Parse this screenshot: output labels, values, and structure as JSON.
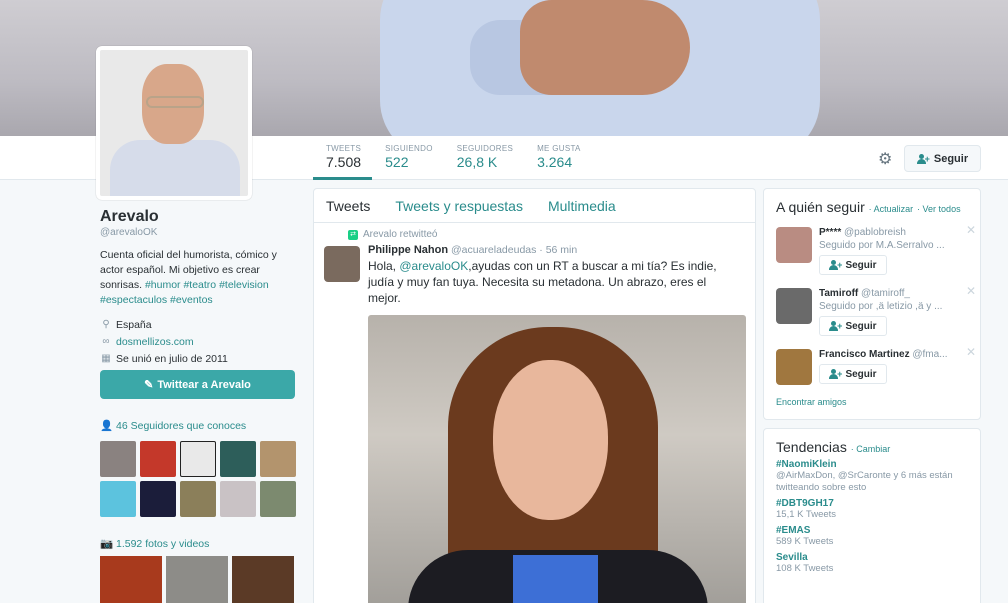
{
  "profile": {
    "name": "Arevalo",
    "handle": "@arevaloOK",
    "bio_text": "Cuenta oficial del humorista, cómico y actor español. Mi objetivo es crear sonrisas.",
    "bio_tags": "#humor #teatro #television #espectaculos #eventos",
    "location": "España",
    "website": "dosmellizos.com",
    "joined": "Se unió en julio de 2011",
    "tweet_button": "Twittear a Arevalo",
    "followers_you_know": "46 Seguidores que conoces",
    "photos_videos": "1.592 fotos y videos"
  },
  "stats": [
    {
      "label": "TWEETS",
      "value": "7.508"
    },
    {
      "label": "SIGUIENDO",
      "value": "522"
    },
    {
      "label": "SEGUIDORES",
      "value": "26,8 K"
    },
    {
      "label": "ME GUSTA",
      "value": "3.264"
    }
  ],
  "header": {
    "follow_label": "Seguir"
  },
  "timeline": {
    "tabs": [
      "Tweets",
      "Tweets y respuestas",
      "Multimedia"
    ],
    "retweet_note": "Arevalo retwitteó",
    "tweet": {
      "author": "Philippe Nahon",
      "author_handle": "@acuareladeudas",
      "time": "· 56 min",
      "text_before": "Hola, ",
      "mention": "@arevaloOK",
      "text_after": ",ayudas con un RT a buscar a mi tía? Es indie, judía y muy fan tuya. Necesita su metadona. Un abrazo, eres el mejor."
    }
  },
  "who_to_follow": {
    "title": "A quién seguir",
    "refresh": "· Actualizar",
    "view_all": "· Ver todos",
    "follow_label": "Seguir",
    "find_friends": "Encontrar amigos",
    "items": [
      {
        "name": "P****",
        "handle": "@pablobreish",
        "sub": "Seguido por M.A.Serralvo ..."
      },
      {
        "name": "Tamiroff",
        "handle": "@tamiroff_",
        "sub": "Seguido por ,ä letizio ,ä y ..."
      },
      {
        "name": "Francisco Martinez",
        "handle": "@fma...",
        "sub": ""
      }
    ]
  },
  "trends": {
    "title": "Tendencias",
    "change": "· Cambiar",
    "items": [
      {
        "tag": "#NaomiKlein",
        "desc": "@AirMaxDon, @SrCaronte y 6 más están twitteando sobre esto"
      },
      {
        "tag": "#DBT9GH17",
        "desc": "15,1 K Tweets"
      },
      {
        "tag": "#EMAS",
        "desc": "589 K Tweets"
      },
      {
        "tag": "Sevilla",
        "desc": "108 K Tweets"
      }
    ]
  },
  "colors": {
    "accent": "#2a8c8c",
    "button": "#3ba8a8"
  }
}
